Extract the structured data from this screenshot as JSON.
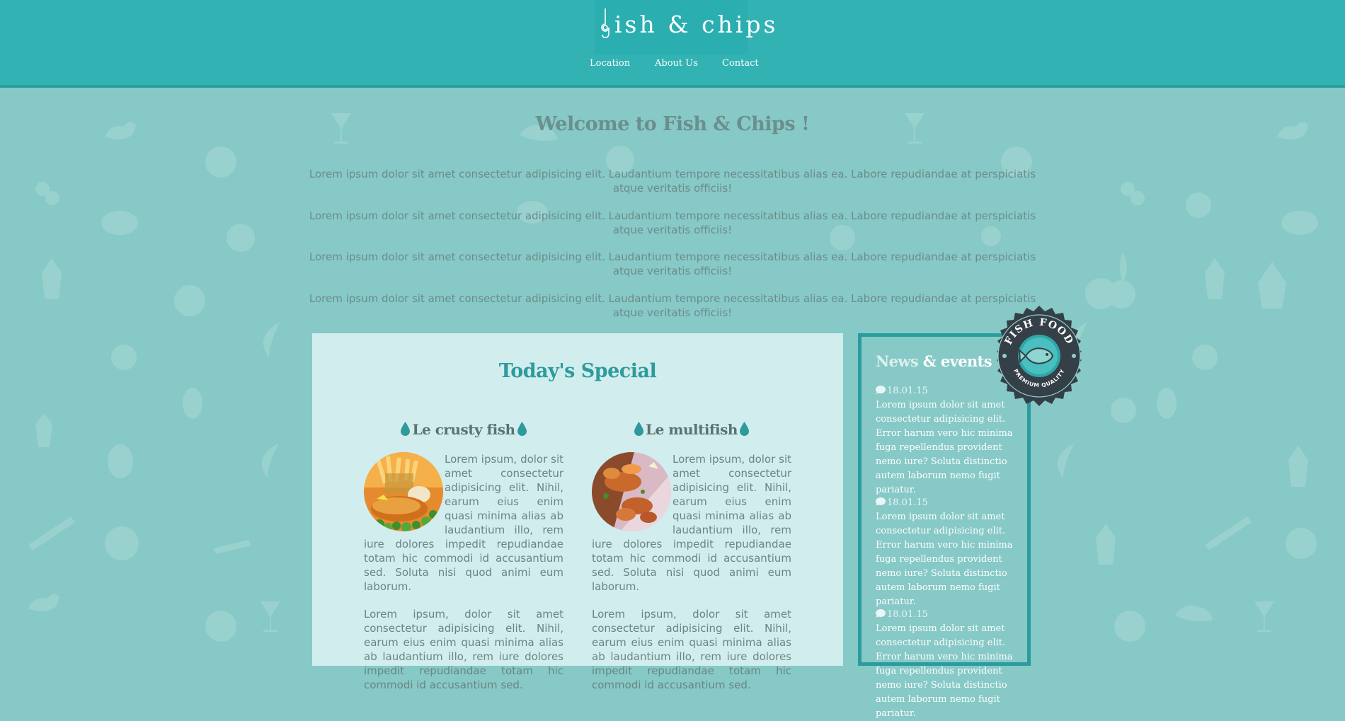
{
  "header": {
    "logo_text": "ish & chips",
    "nav": [
      {
        "label": "Location"
      },
      {
        "label": "About Us"
      },
      {
        "label": "Contact"
      }
    ]
  },
  "welcome": {
    "title": "Welcome to Fish & Chips !",
    "paragraphs": [
      "Lorem ipsum dolor sit amet consectetur adipisicing elit. Laudantium tempore necessitatibus alias ea. Labore repudiandae at perspiciatis atque veritatis officiis!",
      "Lorem ipsum dolor sit amet consectetur adipisicing elit. Laudantium tempore necessitatibus alias ea. Labore repudiandae at perspiciatis atque veritatis officiis!",
      "Lorem ipsum dolor sit amet consectetur adipisicing elit. Laudantium tempore necessitatibus alias ea. Labore repudiandae at perspiciatis atque veritatis officiis!",
      "Lorem ipsum dolor sit amet consectetur adipisicing elit. Laudantium tempore necessitatibus alias ea. Labore repudiandae at perspiciatis atque veritatis officiis!"
    ]
  },
  "special": {
    "title": "Today's Special",
    "dishes": [
      {
        "name": "Le crusty fish",
        "image_icon": "fish-and-chips-photo",
        "text1": "Lorem ipsum, dolor sit amet consectetur adipisicing elit. Nihil, earum eius enim quasi minima alias ab laudantium illo, rem iure dolores impedit repudiandae totam hic commodi id accusantium sed. Soluta nisi quod animi eum laborum.",
        "text2": "Lorem ipsum, dolor sit amet consectetur adipisicing elit. Nihil, earum eius enim quasi minima alias ab laudantium illo, rem iure dolores impedit repudiandae totam hic commodi id accusantium sed."
      },
      {
        "name": "Le multifish",
        "image_icon": "fried-seafood-photo",
        "text1": "Lorem ipsum, dolor sit amet consectetur adipisicing elit. Nihil, earum eius enim quasi minima alias ab laudantium illo, rem iure dolores impedit repudiandae totam hic commodi id accusantium sed. Soluta nisi quod animi eum laborum.",
        "text2": "Lorem ipsum, dolor sit amet consectetur adipisicing elit. Nihil, earum eius enim quasi minima alias ab laudantium illo, rem iure dolores impedit repudiandae totam hic commodi id accusantium sed."
      }
    ]
  },
  "news": {
    "title_part1": "News",
    "title_part2": "& events",
    "items": [
      {
        "date": "18.01.15",
        "text": "Lorem ipsum dolor sit amet consectetur adipisicing elit. Error harum vero hic minima fuga repellendus provident nemo iure? Soluta distinctio autem laborum nemo fugit pariatur."
      },
      {
        "date": "18.01.15",
        "text": "Lorem ipsum dolor sit amet consectetur adipisicing elit. Error harum vero hic minima fuga repellendus provident nemo iure? Soluta distinctio autem laborum nemo fugit pariatur."
      },
      {
        "date": "18.01.15",
        "text": "Lorem ipsum dolor sit amet consectetur adipisicing elit. Error harum vero hic minima fuga repellendus provident nemo iure? Soluta distinctio autem laborum nemo fugit pariatur."
      }
    ]
  },
  "badge": {
    "top_text": "FISH FOOD",
    "bottom_text": "PREMIUM QUALITY"
  },
  "colors": {
    "header": "#32b2b3",
    "background": "#86c9c6",
    "panel": "#d1edee",
    "accent": "#2e9a9b",
    "badge_dark": "#353f47"
  }
}
